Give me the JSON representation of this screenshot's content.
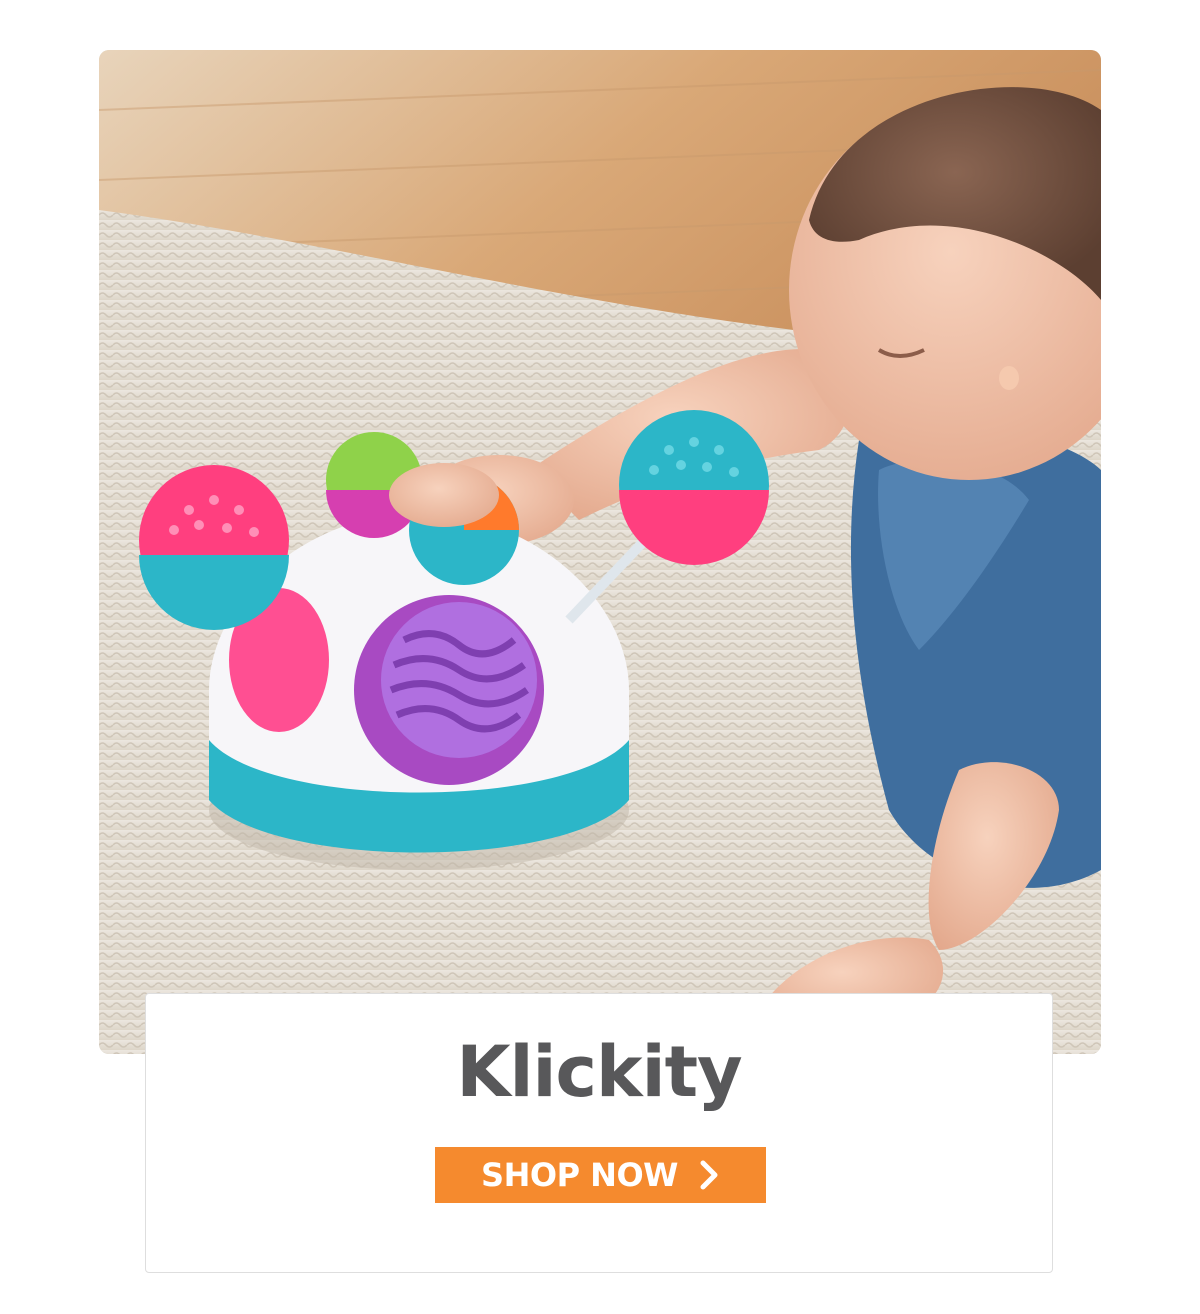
{
  "hero": {
    "image_alt": "Baby playing with a Klickity toy on a rug"
  },
  "product": {
    "name": "Klickity"
  },
  "cta": {
    "label": "SHOP NOW",
    "icon": "chevron-right-icon",
    "background_color": "#f58a2e",
    "text_color": "#ffffff"
  },
  "colors": {
    "title": "#58585a",
    "card_border": "#dedede"
  }
}
